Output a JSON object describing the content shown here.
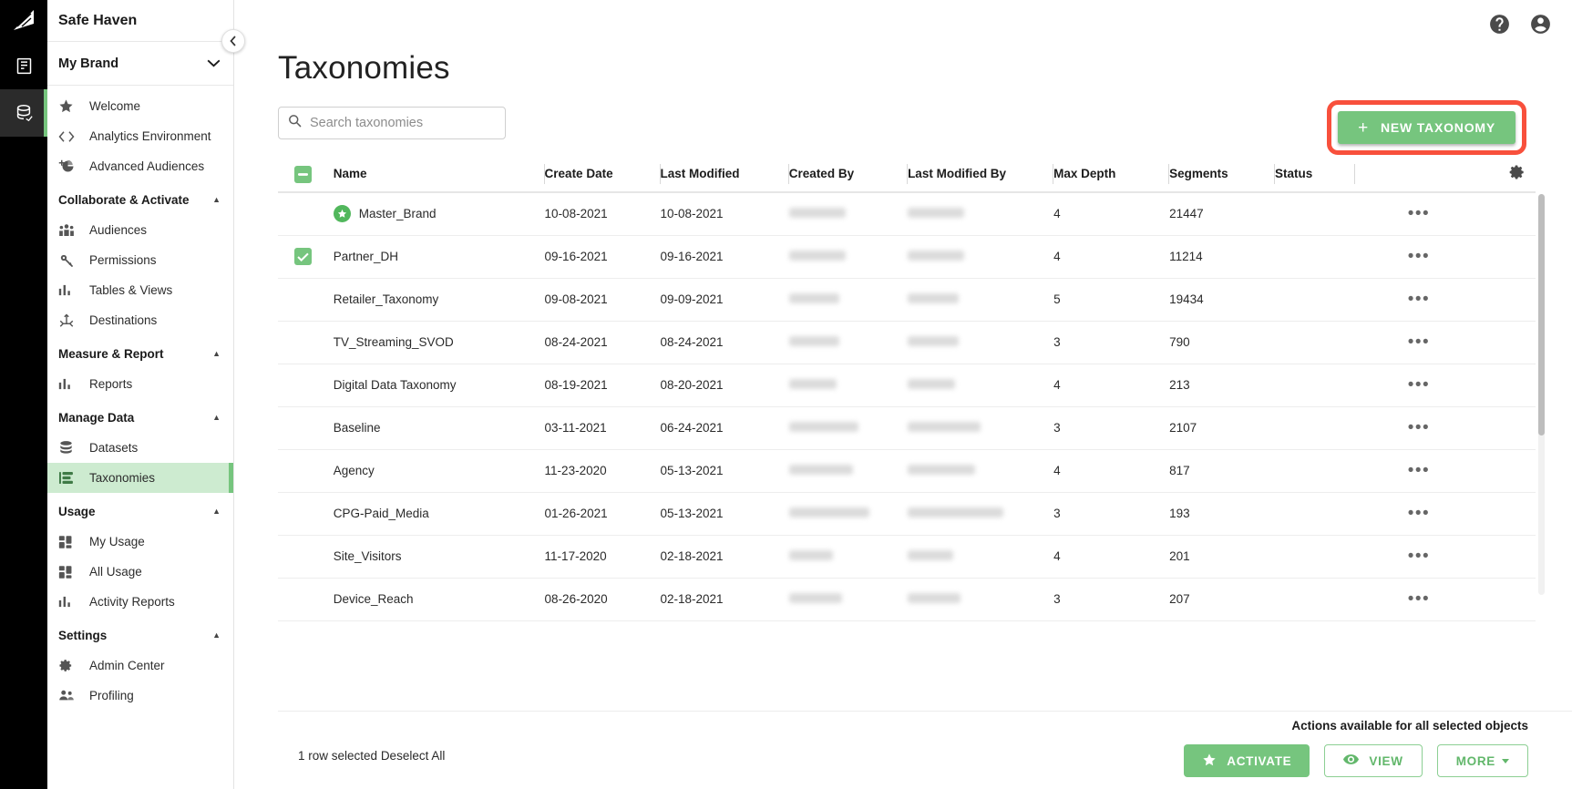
{
  "app": {
    "name": "Safe Haven",
    "brand_selector": "My Brand"
  },
  "icon_rail": {
    "logo": "safe-haven-logo",
    "buttons": [
      {
        "name": "reports-rail-icon",
        "label": ""
      },
      {
        "name": "data-rail-icon",
        "label": ""
      }
    ]
  },
  "sidebar": {
    "collapse_label": "‹",
    "groups": [
      {
        "items": [
          {
            "label": "Welcome",
            "icon": "star-icon",
            "active": false
          },
          {
            "label": "Analytics Environment",
            "icon": "code-brackets-icon",
            "active": false
          },
          {
            "label": "Advanced Audiences",
            "icon": "pie-plus-icon",
            "active": false
          }
        ]
      },
      {
        "title": "Collaborate & Activate",
        "items": [
          {
            "label": "Audiences",
            "icon": "people-icon",
            "active": false
          },
          {
            "label": "Permissions",
            "icon": "key-icon",
            "active": false
          },
          {
            "label": "Tables & Views",
            "icon": "bar-chart-icon",
            "active": false
          },
          {
            "label": "Destinations",
            "icon": "anchor-icon",
            "active": false
          }
        ]
      },
      {
        "title": "Measure & Report",
        "items": [
          {
            "label": "Reports",
            "icon": "bar-chart-icon",
            "active": false
          }
        ]
      },
      {
        "title": "Manage Data",
        "items": [
          {
            "label": "Datasets",
            "icon": "database-icon",
            "active": false
          },
          {
            "label": "Taxonomies",
            "icon": "taxonomy-icon",
            "active": true
          }
        ]
      },
      {
        "title": "Usage",
        "items": [
          {
            "label": "My Usage",
            "icon": "dashboard-icon",
            "active": false
          },
          {
            "label": "All Usage",
            "icon": "dashboard-icon",
            "active": false
          },
          {
            "label": "Activity Reports",
            "icon": "bar-chart-icon",
            "active": false
          }
        ]
      },
      {
        "title": "Settings",
        "items": [
          {
            "label": "Admin Center",
            "icon": "gear-icon",
            "active": false
          },
          {
            "label": "Profiling",
            "icon": "people-icon",
            "active": false
          }
        ]
      }
    ]
  },
  "topbar": {
    "help_icon": "help-circle-icon",
    "account_icon": "account-circle-icon"
  },
  "page": {
    "title": "Taxonomies"
  },
  "search": {
    "placeholder": "Search taxonomies",
    "value": "",
    "icon": "search-icon"
  },
  "new_taxonomy_button": {
    "label": "NEW TAXONOMY",
    "plus": "+",
    "highlight_color": "#f8503c",
    "bg_color": "#76c57e"
  },
  "table": {
    "header_checkbox_state": "indeterminate",
    "settings_icon": "gear-icon",
    "columns": [
      "Name",
      "Create Date",
      "Last Modified",
      "Created By",
      "Last Modified By",
      "Max Depth",
      "Segments",
      "Status"
    ],
    "rows": [
      {
        "name": "Master_Brand",
        "create_date": "10-08-2021",
        "last_modified": "10-08-2021",
        "created_by": "",
        "last_modified_by": "",
        "max_depth": "4",
        "segments": "21447",
        "status": "",
        "selected": false,
        "starred": true,
        "redact_a": 62,
        "redact_b": 62
      },
      {
        "name": "Partner_DH",
        "create_date": "09-16-2021",
        "last_modified": "09-16-2021",
        "created_by": "",
        "last_modified_by": "",
        "max_depth": "4",
        "segments": "11214",
        "status": "",
        "selected": true,
        "starred": false,
        "redact_a": 62,
        "redact_b": 62
      },
      {
        "name": "Retailer_Taxonomy",
        "create_date": "09-08-2021",
        "last_modified": "09-09-2021",
        "created_by": "",
        "last_modified_by": "",
        "max_depth": "5",
        "segments": "19434",
        "status": "",
        "selected": false,
        "starred": false,
        "redact_a": 55,
        "redact_b": 56
      },
      {
        "name": "TV_Streaming_SVOD",
        "create_date": "08-24-2021",
        "last_modified": "08-24-2021",
        "created_by": "",
        "last_modified_by": "",
        "max_depth": "3",
        "segments": "790",
        "status": "",
        "selected": false,
        "starred": false,
        "redact_a": 55,
        "redact_b": 56
      },
      {
        "name": "Digital Data Taxonomy",
        "create_date": "08-19-2021",
        "last_modified": "08-20-2021",
        "created_by": "",
        "last_modified_by": "",
        "max_depth": "4",
        "segments": "213",
        "status": "",
        "selected": false,
        "starred": false,
        "redact_a": 52,
        "redact_b": 52
      },
      {
        "name": "Baseline",
        "create_date": "03-11-2021",
        "last_modified": "06-24-2021",
        "created_by": "",
        "last_modified_by": "",
        "max_depth": "3",
        "segments": "2107",
        "status": "",
        "selected": false,
        "starred": false,
        "redact_a": 76,
        "redact_b": 80
      },
      {
        "name": "Agency",
        "create_date": "11-23-2020",
        "last_modified": "05-13-2021",
        "created_by": "",
        "last_modified_by": "",
        "max_depth": "4",
        "segments": "817",
        "status": "",
        "selected": false,
        "starred": false,
        "redact_a": 70,
        "redact_b": 74
      },
      {
        "name": "CPG-Paid_Media",
        "create_date": "01-26-2021",
        "last_modified": "05-13-2021",
        "created_by": "",
        "last_modified_by": "",
        "max_depth": "3",
        "segments": "193",
        "status": "",
        "selected": false,
        "starred": false,
        "redact_a": 88,
        "redact_b": 105
      },
      {
        "name": "Site_Visitors",
        "create_date": "11-17-2020",
        "last_modified": "02-18-2021",
        "created_by": "",
        "last_modified_by": "",
        "max_depth": "4",
        "segments": "201",
        "status": "",
        "selected": false,
        "starred": false,
        "redact_a": 48,
        "redact_b": 50
      },
      {
        "name": "Device_Reach",
        "create_date": "08-26-2020",
        "last_modified": "02-18-2021",
        "created_by": "",
        "last_modified_by": "",
        "max_depth": "3",
        "segments": "207",
        "status": "",
        "selected": false,
        "starred": false,
        "redact_a": 58,
        "redact_b": 58
      }
    ],
    "row_menu_glyph": "•••"
  },
  "footer": {
    "selection_text": "1 row selected",
    "deselect_label": "Deselect All",
    "actions_title": "Actions available for all selected objects",
    "buttons": [
      {
        "label": "ACTIVATE",
        "icon": "star-icon",
        "style": "primary"
      },
      {
        "label": "VIEW",
        "icon": "eye-icon",
        "style": "outline"
      },
      {
        "label": "MORE",
        "icon": "chevron-down-icon",
        "style": "outline"
      }
    ]
  }
}
